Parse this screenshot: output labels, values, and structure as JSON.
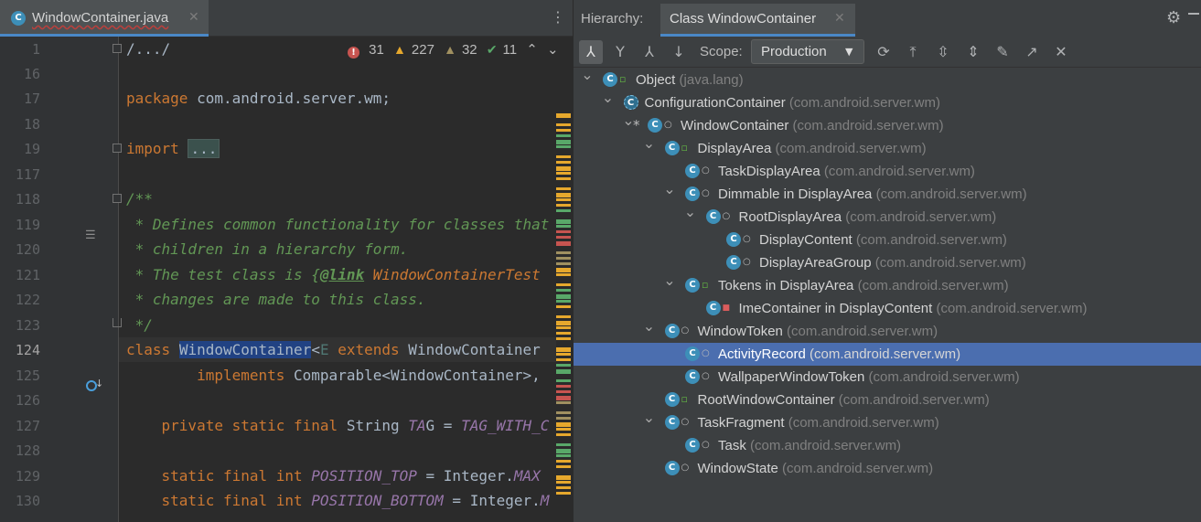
{
  "editor": {
    "tab_title": "WindowContainer.java",
    "tab_icon": "C",
    "inspections": {
      "errors": "31",
      "warnings": "227",
      "weak_warnings": "32",
      "typos": "11"
    },
    "lines": [
      {
        "num": "1",
        "code": "/.../"
      },
      {
        "num": "16",
        "code": ""
      },
      {
        "num": "17",
        "code": "package com.android.server.wm;"
      },
      {
        "num": "18",
        "code": ""
      },
      {
        "num": "19",
        "code": "import ..."
      },
      {
        "num": "117",
        "code": ""
      },
      {
        "num": "118",
        "code": "/**"
      },
      {
        "num": "119",
        "code": " * Defines common functionality for classes that"
      },
      {
        "num": "120",
        "code": " * children in a hierarchy form."
      },
      {
        "num": "121",
        "code": " * The test class is {@link WindowContainerTest"
      },
      {
        "num": "122",
        "code": " * changes are made to this class."
      },
      {
        "num": "123",
        "code": " */"
      },
      {
        "num": "124",
        "code": "class WindowContainer<E extends WindowContainer"
      },
      {
        "num": "125",
        "code": "        implements Comparable<WindowContainer>,"
      },
      {
        "num": "126",
        "code": ""
      },
      {
        "num": "127",
        "code": "    private static final String TAG = TAG_WITH_C"
      },
      {
        "num": "128",
        "code": ""
      },
      {
        "num": "129",
        "code": "    static final int POSITION_TOP = Integer.MAX"
      },
      {
        "num": "130",
        "code": "    static final int POSITION_BOTTOM = Integer.M"
      }
    ]
  },
  "hierarchy": {
    "title": "Hierarchy:",
    "tab_label": "Class WindowContainer",
    "scope_label": "Scope:",
    "scope_value": "Production",
    "toolbar_icons": [
      "subtypes-hierarchy-icon",
      "supertypes-hierarchy-icon",
      "class-hierarchy-icon",
      "sort-alpha-icon",
      "refresh-icon",
      "autoscroll-to-source-icon",
      "expand-all-icon",
      "collapse-all-icon",
      "pin-icon",
      "export-icon",
      "close-icon"
    ],
    "tree": [
      {
        "depth": 0,
        "arrow": "open",
        "name": "Object",
        "pkg": "(java.lang)",
        "mod": "public",
        "star": false
      },
      {
        "depth": 1,
        "arrow": "open",
        "name": "ConfigurationContainer",
        "pkg": "(com.android.server.wm)",
        "mod": "none",
        "abstract": true,
        "star": false
      },
      {
        "depth": 2,
        "arrow": "open",
        "name": "WindowContainer",
        "pkg": "(com.android.server.wm)",
        "mod": "package",
        "star": true
      },
      {
        "depth": 3,
        "arrow": "open",
        "name": "DisplayArea",
        "pkg": "(com.android.server.wm)",
        "mod": "public",
        "star": false
      },
      {
        "depth": 4,
        "arrow": "none",
        "name": "TaskDisplayArea",
        "pkg": "(com.android.server.wm)",
        "mod": "package",
        "star": false
      },
      {
        "depth": 4,
        "arrow": "open",
        "name": "Dimmable in DisplayArea",
        "pkg": "(com.android.server.wm)",
        "mod": "package",
        "star": false
      },
      {
        "depth": 5,
        "arrow": "open",
        "name": "RootDisplayArea",
        "pkg": "(com.android.server.wm)",
        "mod": "package",
        "star": false
      },
      {
        "depth": 6,
        "arrow": "none",
        "name": "DisplayContent",
        "pkg": "(com.android.server.wm)",
        "mod": "package",
        "star": false
      },
      {
        "depth": 6,
        "arrow": "none",
        "name": "DisplayAreaGroup",
        "pkg": "(com.android.server.wm)",
        "mod": "package",
        "star": false
      },
      {
        "depth": 4,
        "arrow": "open",
        "name": "Tokens in DisplayArea",
        "pkg": "(com.android.server.wm)",
        "mod": "public",
        "star": false
      },
      {
        "depth": 5,
        "arrow": "none",
        "name": "ImeContainer in DisplayContent",
        "pkg": "(com.android.server.wm)",
        "mod": "private",
        "star": false
      },
      {
        "depth": 3,
        "arrow": "open",
        "name": "WindowToken",
        "pkg": "(com.android.server.wm)",
        "mod": "package",
        "star": false
      },
      {
        "depth": 4,
        "arrow": "none",
        "name": "ActivityRecord",
        "pkg": "(com.android.server.wm)",
        "mod": "package",
        "star": false,
        "selected": true
      },
      {
        "depth": 4,
        "arrow": "none",
        "name": "WallpaperWindowToken",
        "pkg": "(com.android.server.wm)",
        "mod": "package",
        "star": false
      },
      {
        "depth": 3,
        "arrow": "none",
        "name": "RootWindowContainer",
        "pkg": "(com.android.server.wm)",
        "mod": "public",
        "star": false
      },
      {
        "depth": 3,
        "arrow": "open",
        "name": "TaskFragment",
        "pkg": "(com.android.server.wm)",
        "mod": "package",
        "star": false
      },
      {
        "depth": 4,
        "arrow": "none",
        "name": "Task",
        "pkg": "(com.android.server.wm)",
        "mod": "package",
        "star": false
      },
      {
        "depth": 3,
        "arrow": "none",
        "name": "WindowState",
        "pkg": "(com.android.server.wm)",
        "mod": "package",
        "star": false
      }
    ]
  },
  "colors": {
    "accent": "#4a88c7",
    "selection": "#4b6eaf",
    "keyword": "#cc7832",
    "comment": "#629755",
    "constant": "#9876aa",
    "class_icon": "#3d8fb8"
  }
}
